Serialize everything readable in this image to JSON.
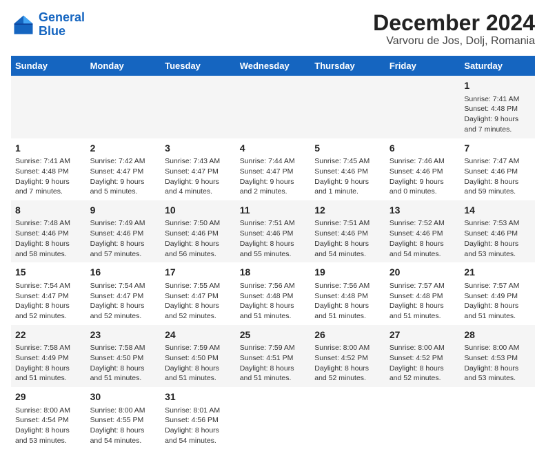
{
  "header": {
    "logo_line1": "General",
    "logo_line2": "Blue",
    "title": "December 2024",
    "subtitle": "Varvoru de Jos, Dolj, Romania"
  },
  "calendar": {
    "days_of_week": [
      "Sunday",
      "Monday",
      "Tuesday",
      "Wednesday",
      "Thursday",
      "Friday",
      "Saturday"
    ],
    "weeks": [
      [
        null,
        null,
        null,
        null,
        null,
        null,
        {
          "day": "1",
          "sunrise": "Sunrise: 7:41 AM",
          "sunset": "Sunset: 4:48 PM",
          "daylight": "Daylight: 9 hours and 7 minutes."
        }
      ],
      [
        {
          "day": "1",
          "sunrise": "Sunrise: 7:41 AM",
          "sunset": "Sunset: 4:48 PM",
          "daylight": "Daylight: 9 hours and 7 minutes."
        },
        {
          "day": "2",
          "sunrise": "Sunrise: 7:42 AM",
          "sunset": "Sunset: 4:47 PM",
          "daylight": "Daylight: 9 hours and 5 minutes."
        },
        {
          "day": "3",
          "sunrise": "Sunrise: 7:43 AM",
          "sunset": "Sunset: 4:47 PM",
          "daylight": "Daylight: 9 hours and 4 minutes."
        },
        {
          "day": "4",
          "sunrise": "Sunrise: 7:44 AM",
          "sunset": "Sunset: 4:47 PM",
          "daylight": "Daylight: 9 hours and 2 minutes."
        },
        {
          "day": "5",
          "sunrise": "Sunrise: 7:45 AM",
          "sunset": "Sunset: 4:46 PM",
          "daylight": "Daylight: 9 hours and 1 minute."
        },
        {
          "day": "6",
          "sunrise": "Sunrise: 7:46 AM",
          "sunset": "Sunset: 4:46 PM",
          "daylight": "Daylight: 9 hours and 0 minutes."
        },
        {
          "day": "7",
          "sunrise": "Sunrise: 7:47 AM",
          "sunset": "Sunset: 4:46 PM",
          "daylight": "Daylight: 8 hours and 59 minutes."
        }
      ],
      [
        {
          "day": "8",
          "sunrise": "Sunrise: 7:48 AM",
          "sunset": "Sunset: 4:46 PM",
          "daylight": "Daylight: 8 hours and 58 minutes."
        },
        {
          "day": "9",
          "sunrise": "Sunrise: 7:49 AM",
          "sunset": "Sunset: 4:46 PM",
          "daylight": "Daylight: 8 hours and 57 minutes."
        },
        {
          "day": "10",
          "sunrise": "Sunrise: 7:50 AM",
          "sunset": "Sunset: 4:46 PM",
          "daylight": "Daylight: 8 hours and 56 minutes."
        },
        {
          "day": "11",
          "sunrise": "Sunrise: 7:51 AM",
          "sunset": "Sunset: 4:46 PM",
          "daylight": "Daylight: 8 hours and 55 minutes."
        },
        {
          "day": "12",
          "sunrise": "Sunrise: 7:51 AM",
          "sunset": "Sunset: 4:46 PM",
          "daylight": "Daylight: 8 hours and 54 minutes."
        },
        {
          "day": "13",
          "sunrise": "Sunrise: 7:52 AM",
          "sunset": "Sunset: 4:46 PM",
          "daylight": "Daylight: 8 hours and 54 minutes."
        },
        {
          "day": "14",
          "sunrise": "Sunrise: 7:53 AM",
          "sunset": "Sunset: 4:46 PM",
          "daylight": "Daylight: 8 hours and 53 minutes."
        }
      ],
      [
        {
          "day": "15",
          "sunrise": "Sunrise: 7:54 AM",
          "sunset": "Sunset: 4:47 PM",
          "daylight": "Daylight: 8 hours and 52 minutes."
        },
        {
          "day": "16",
          "sunrise": "Sunrise: 7:54 AM",
          "sunset": "Sunset: 4:47 PM",
          "daylight": "Daylight: 8 hours and 52 minutes."
        },
        {
          "day": "17",
          "sunrise": "Sunrise: 7:55 AM",
          "sunset": "Sunset: 4:47 PM",
          "daylight": "Daylight: 8 hours and 52 minutes."
        },
        {
          "day": "18",
          "sunrise": "Sunrise: 7:56 AM",
          "sunset": "Sunset: 4:48 PM",
          "daylight": "Daylight: 8 hours and 51 minutes."
        },
        {
          "day": "19",
          "sunrise": "Sunrise: 7:56 AM",
          "sunset": "Sunset: 4:48 PM",
          "daylight": "Daylight: 8 hours and 51 minutes."
        },
        {
          "day": "20",
          "sunrise": "Sunrise: 7:57 AM",
          "sunset": "Sunset: 4:48 PM",
          "daylight": "Daylight: 8 hours and 51 minutes."
        },
        {
          "day": "21",
          "sunrise": "Sunrise: 7:57 AM",
          "sunset": "Sunset: 4:49 PM",
          "daylight": "Daylight: 8 hours and 51 minutes."
        }
      ],
      [
        {
          "day": "22",
          "sunrise": "Sunrise: 7:58 AM",
          "sunset": "Sunset: 4:49 PM",
          "daylight": "Daylight: 8 hours and 51 minutes."
        },
        {
          "day": "23",
          "sunrise": "Sunrise: 7:58 AM",
          "sunset": "Sunset: 4:50 PM",
          "daylight": "Daylight: 8 hours and 51 minutes."
        },
        {
          "day": "24",
          "sunrise": "Sunrise: 7:59 AM",
          "sunset": "Sunset: 4:50 PM",
          "daylight": "Daylight: 8 hours and 51 minutes."
        },
        {
          "day": "25",
          "sunrise": "Sunrise: 7:59 AM",
          "sunset": "Sunset: 4:51 PM",
          "daylight": "Daylight: 8 hours and 51 minutes."
        },
        {
          "day": "26",
          "sunrise": "Sunrise: 8:00 AM",
          "sunset": "Sunset: 4:52 PM",
          "daylight": "Daylight: 8 hours and 52 minutes."
        },
        {
          "day": "27",
          "sunrise": "Sunrise: 8:00 AM",
          "sunset": "Sunset: 4:52 PM",
          "daylight": "Daylight: 8 hours and 52 minutes."
        },
        {
          "day": "28",
          "sunrise": "Sunrise: 8:00 AM",
          "sunset": "Sunset: 4:53 PM",
          "daylight": "Daylight: 8 hours and 53 minutes."
        }
      ],
      [
        {
          "day": "29",
          "sunrise": "Sunrise: 8:00 AM",
          "sunset": "Sunset: 4:54 PM",
          "daylight": "Daylight: 8 hours and 53 minutes."
        },
        {
          "day": "30",
          "sunrise": "Sunrise: 8:00 AM",
          "sunset": "Sunset: 4:55 PM",
          "daylight": "Daylight: 8 hours and 54 minutes."
        },
        {
          "day": "31",
          "sunrise": "Sunrise: 8:01 AM",
          "sunset": "Sunset: 4:56 PM",
          "daylight": "Daylight: 8 hours and 54 minutes."
        },
        null,
        null,
        null,
        null
      ]
    ]
  }
}
